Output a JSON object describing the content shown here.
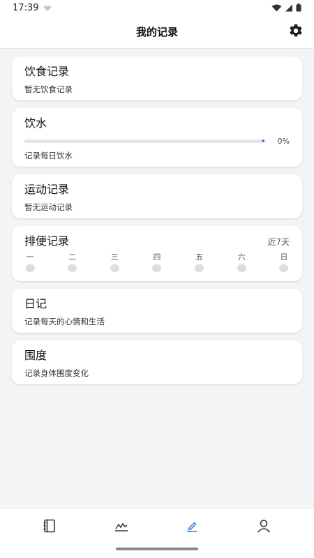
{
  "status_bar": {
    "time": "17:39"
  },
  "header": {
    "title": "我的记录"
  },
  "cards": {
    "food": {
      "title": "饮食记录",
      "subtitle": "暂无饮食记录"
    },
    "water": {
      "title": "饮水",
      "progress": 0,
      "percent_label": "0%",
      "subtitle": "记录每日饮水"
    },
    "sport": {
      "title": "运动记录",
      "subtitle": "暂无运动记录"
    },
    "stool": {
      "title": "排便记录",
      "range_label": "近7天",
      "days": [
        "一",
        "二",
        "三",
        "四",
        "五",
        "六",
        "日"
      ]
    },
    "diary": {
      "title": "日记",
      "subtitle": "记录每天的心情和生活"
    },
    "girth": {
      "title": "围度",
      "subtitle": "记录身体围度变化"
    }
  },
  "tabbar": {
    "active_index": 2,
    "active_color": "#3a7bd5",
    "inactive_color": "#333333"
  }
}
